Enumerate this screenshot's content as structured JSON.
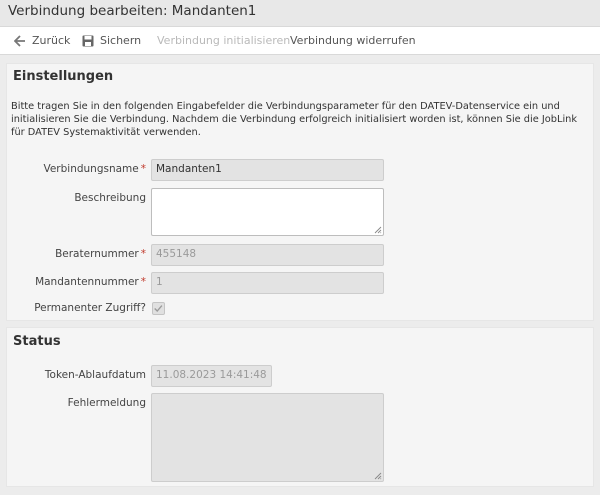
{
  "header": {
    "title": "Verbindung bearbeiten: Mandanten1"
  },
  "toolbar": {
    "back_label": "Zurück",
    "save_label": "Sichern",
    "init_label": "Verbindung initialisieren",
    "revoke_label": "Verbindung widerrufen"
  },
  "settings": {
    "title": "Einstellungen",
    "intro": "Bitte tragen Sie in den folgenden Eingabefelder die Verbindungsparameter für den DATEV-Datenservice ein und initialisieren Sie die Verbindung. Nachdem die Verbindung erfolgreich initialisiert worden ist, können Sie die JobLink für DATEV Systemaktivität verwenden.",
    "name_label": "Verbindungsname",
    "name_value": "Mandanten1",
    "description_label": "Beschreibung",
    "advisor_label": "Beraternummer",
    "advisor_value": "455148",
    "client_label": "Mandantennummer",
    "client_value": "1",
    "permanent_label": "Permanenter Zugriff?",
    "permanent_checked": true,
    "required_marker": "*"
  },
  "status": {
    "title": "Status",
    "token_label": "Token-Ablaufdatum",
    "token_value": "11.08.2023 14:41:48",
    "error_label": "Fehlermeldung"
  },
  "colors": {
    "required": "#c0392b",
    "disabled_text": "#b9b9b9"
  }
}
